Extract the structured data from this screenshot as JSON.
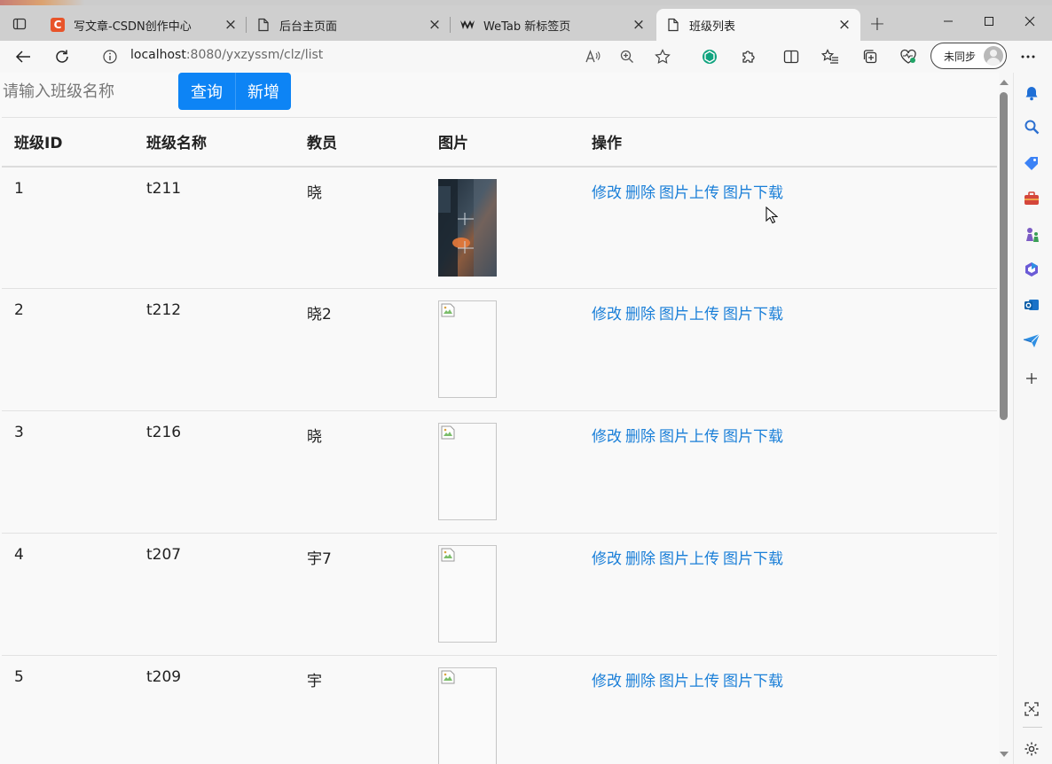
{
  "browser": {
    "tabs": [
      {
        "title": "写文章-CSDN创作中心",
        "favicon": "csdn-icon",
        "favicon_letter": "C",
        "active": false
      },
      {
        "title": "后台主页面",
        "favicon": "page-icon",
        "active": false
      },
      {
        "title": "WeTab 新标签页",
        "favicon": "wetab-icon",
        "active": false
      },
      {
        "title": "班级列表",
        "favicon": "page-icon",
        "active": true
      }
    ],
    "url_host": "localhost",
    "url_rest": ":8080/yxzyssm/clz/list",
    "sync_label": "未同步"
  },
  "page": {
    "search": {
      "placeholder": "请输入班级名称",
      "value": ""
    },
    "query_label": "查询",
    "add_label": "新增",
    "table": {
      "headers": [
        "班级ID",
        "班级名称",
        "教员",
        "图片",
        "操作"
      ],
      "actions": [
        "修改",
        "删除",
        "图片上传",
        "图片下载"
      ],
      "rows": [
        {
          "id": "1",
          "name": "t211",
          "teacher": "晓",
          "image": "photo"
        },
        {
          "id": "2",
          "name": "t212",
          "teacher": "晓2",
          "image": "broken"
        },
        {
          "id": "3",
          "name": "t216",
          "teacher": "晓",
          "image": "broken"
        },
        {
          "id": "4",
          "name": "t207",
          "teacher": "宇7",
          "image": "broken"
        },
        {
          "id": "5",
          "name": "t209",
          "teacher": "宇",
          "image": "broken"
        }
      ]
    }
  },
  "colors": {
    "primary_button": "#0d84f5",
    "link": "#1a7fd8",
    "accent": "#0d84f5"
  }
}
